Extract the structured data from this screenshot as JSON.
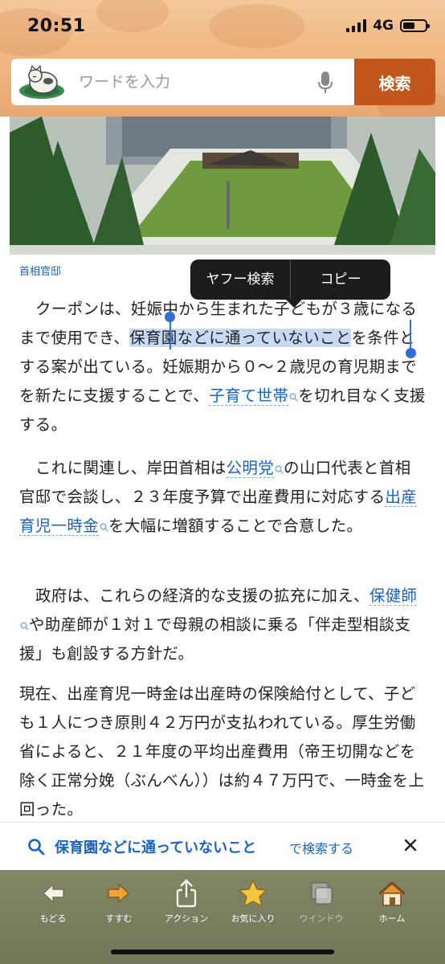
{
  "status_bar": {
    "time": "20:51",
    "network": "4G"
  },
  "search": {
    "placeholder": "ワードを入力",
    "button_label": "検索"
  },
  "photo": {
    "caption": "首相官邸"
  },
  "context_menu": {
    "items": [
      "ヤフー検索",
      "コピー"
    ]
  },
  "article": {
    "p1": {
      "before_selection": "クーポンは、妊娠中から生まれた子どもが３歳になるまで使用でき、",
      "selection": "保育園などに通っていないこと",
      "after_selection": "を条件とする案が出ている。妊娠期から０～２歳児の育児期までを新たに支援することで、",
      "keyword": "子育て世帯",
      "tail": "を切れ目なく支援する。"
    },
    "p2": {
      "text1": "これに関連し、岸田首相は",
      "keyword1": "公明党",
      "text2": "の山口代表と首相官邸で会談し、２３年度予算で出産費用に対応する",
      "keyword2": "出産育児一時金",
      "text3": "を大幅に増額することで合意した。"
    },
    "p3": {
      "text1": "政府は、これらの経済的な支援の拡充に加え、",
      "keyword": "保健師",
      "text2": "や助産師が１対１で母親の相談に乗る「伴走型相談支援」も創設する方針だ。"
    },
    "p4": {
      "text": "現在、出産育児一時金は出産時の保険給付として、子ども１人につき原則４２万円が支払われている。厚生労働省によると、２１年度の平均出産費用（帝王切開などを除く正常分娩（ぶんべん））は約４７万円で、一時金を上回った。"
    }
  },
  "suggest_bar": {
    "query": "保育園などに通っていないこと",
    "suffix": "で検索する"
  },
  "toolbar": {
    "items": [
      {
        "label": "もどる",
        "icon": "back-arrow-icon"
      },
      {
        "label": "すすむ",
        "icon": "forward-arrow-icon"
      },
      {
        "label": "アクション",
        "icon": "share-icon"
      },
      {
        "label": "お気に入り",
        "icon": "star-icon"
      },
      {
        "label": "ウインドウ",
        "icon": "windows-icon"
      },
      {
        "label": "ホーム",
        "icon": "home-icon"
      }
    ]
  },
  "colors": {
    "header_bg": "#f0b884",
    "search_button": "#c2561b",
    "link_blue": "#1a64c6",
    "selection": "#c8daf3",
    "toolbar_bg": "#6c7252"
  }
}
